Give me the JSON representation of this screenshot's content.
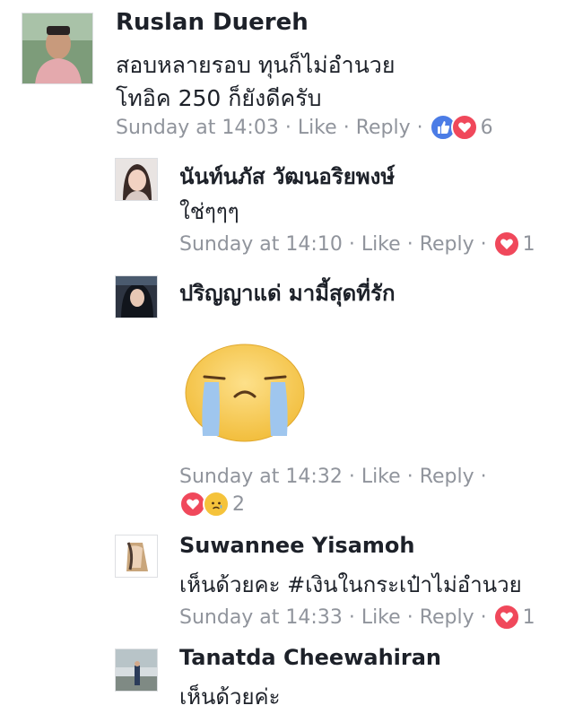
{
  "comments": [
    {
      "author": "Ruslan Duereh",
      "lines": [
        "สอบหลายรอบ ทุนก็ไม่อำนวย",
        "โทอิค 250 ก็ยังดีครับ"
      ],
      "time": "Sunday at 14:03",
      "like": "Like",
      "reply": "Reply",
      "reactions": [
        "like",
        "love"
      ],
      "reaction_count": "6"
    },
    {
      "author": "นันท์นภัส วัฒนอริยพงษ์",
      "lines": [
        "ใช่ๆๆๆ"
      ],
      "time": "Sunday at 14:10",
      "like": "Like",
      "reply": "Reply",
      "reactions": [
        "love"
      ],
      "reaction_count": "1"
    },
    {
      "author": "ปริญญาแด่ มามี้สุดที่รัก",
      "sticker": "crying-face-sticker",
      "time": "Sunday at 14:32",
      "like": "Like",
      "reply": "Reply",
      "reactions": [
        "love",
        "sad"
      ],
      "reaction_count": "2"
    },
    {
      "author": "Suwannee Yisamoh",
      "lines": [
        "เห็นด้วยคะ #เงินในกระเป๋าไม่อำนวย"
      ],
      "time": "Sunday at 14:33",
      "like": "Like",
      "reply": "Reply",
      "reactions": [
        "love"
      ],
      "reaction_count": "1"
    },
    {
      "author": "Tanatda Cheewahiran",
      "lines": [
        "เห็นด้วยค่ะ"
      ]
    }
  ],
  "colors": {
    "like_blue": "#4b7ce6",
    "love_red": "#f0485b",
    "meta_gray": "#90949c",
    "sad_yellow": "#f5c33b"
  }
}
